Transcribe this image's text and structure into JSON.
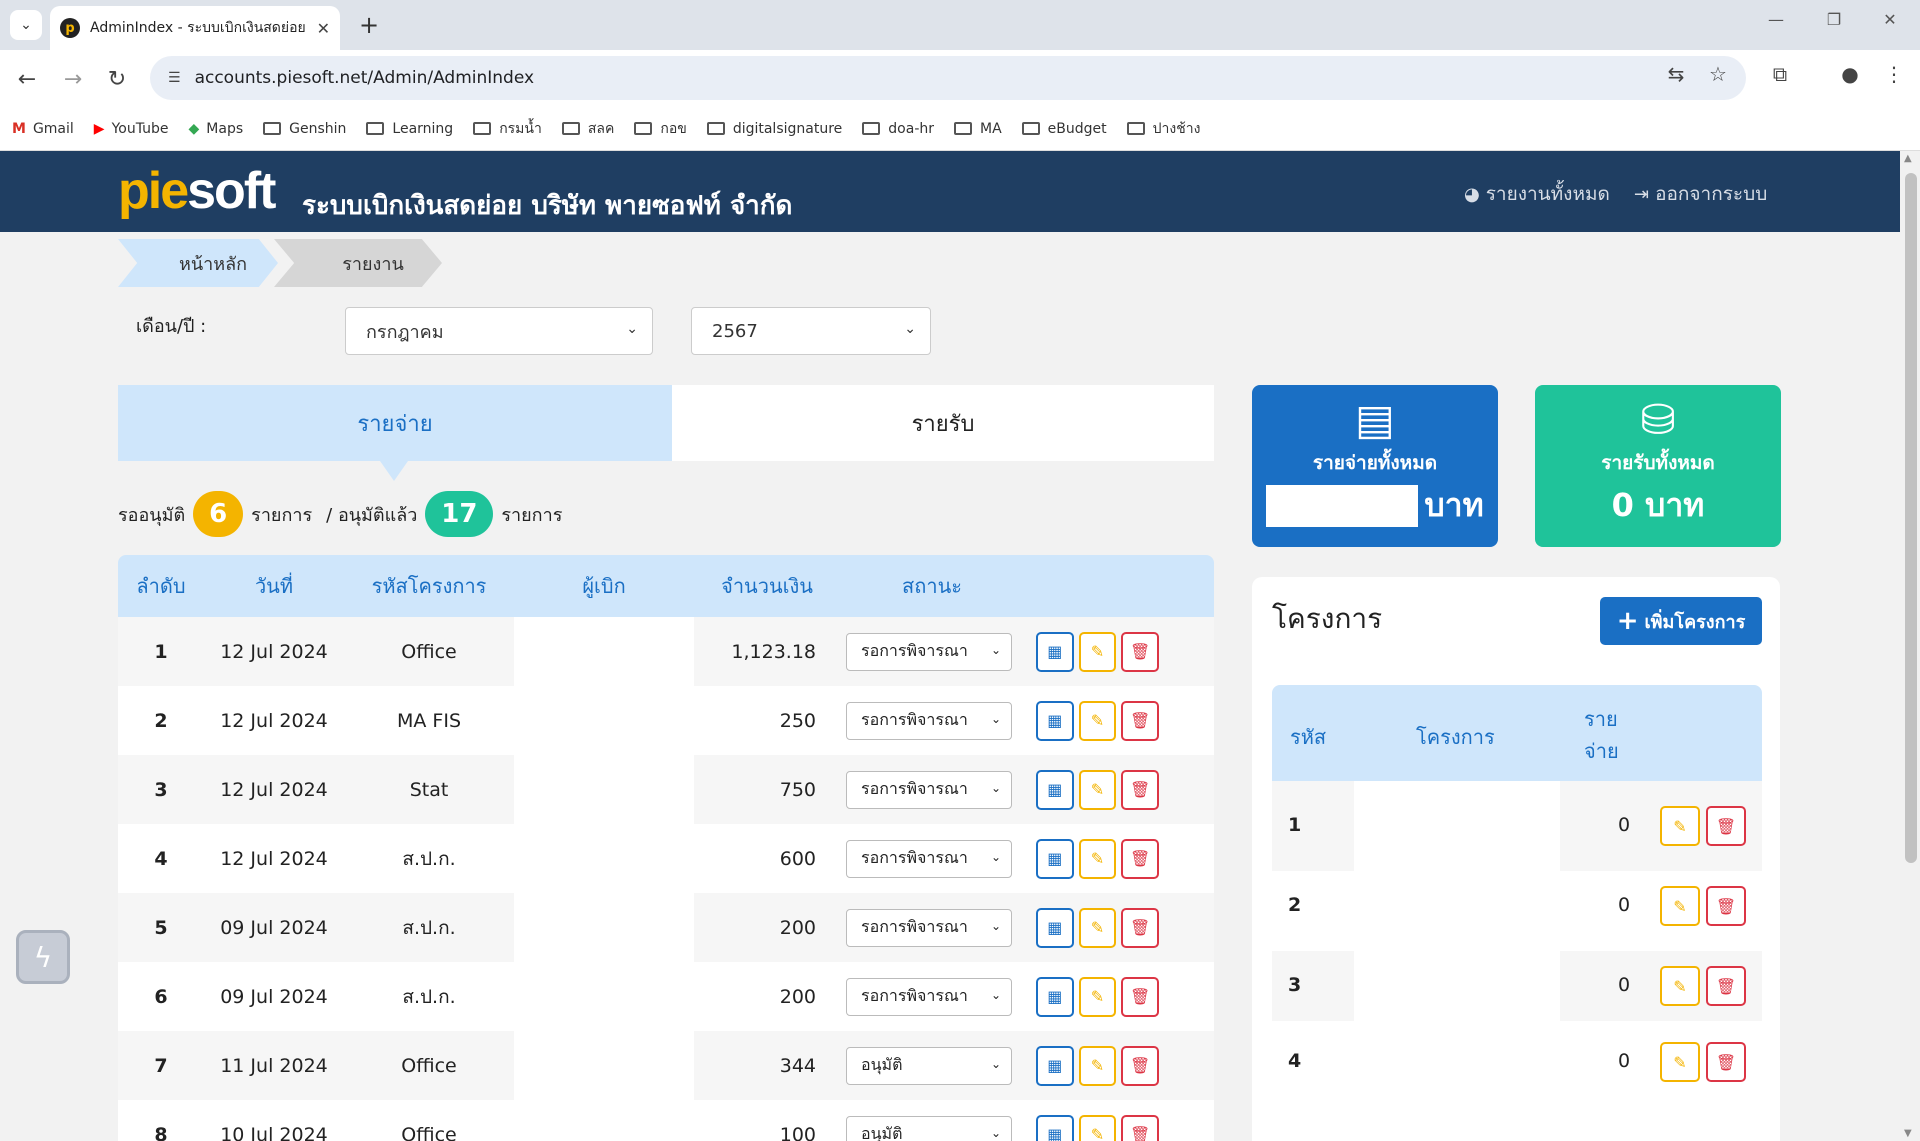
{
  "browser": {
    "tab_title": "AdminIndex - ระบบเบิกเงินสดย่อย",
    "url": "accounts.piesoft.net/Admin/AdminIndex",
    "bookmarks": [
      {
        "label": "Gmail",
        "icon": "gmail-icon"
      },
      {
        "label": "YouTube",
        "icon": "youtube-icon"
      },
      {
        "label": "Maps",
        "icon": "maps-icon"
      },
      {
        "label": "Genshin",
        "icon": "folder-icon"
      },
      {
        "label": "Learning",
        "icon": "folder-icon"
      },
      {
        "label": "กรมน้ำ",
        "icon": "folder-icon"
      },
      {
        "label": "สลค",
        "icon": "folder-icon"
      },
      {
        "label": "กอข",
        "icon": "folder-icon"
      },
      {
        "label": "digitalsignature",
        "icon": "folder-icon"
      },
      {
        "label": "doa-hr",
        "icon": "folder-icon"
      },
      {
        "label": "MA",
        "icon": "folder-icon"
      },
      {
        "label": "eBudget",
        "icon": "folder-icon"
      },
      {
        "label": "ปางช้าง",
        "icon": "folder-icon"
      }
    ]
  },
  "header": {
    "logo_pie": "pie",
    "logo_soft": "soft",
    "title": "ระบบเบิกเงินสดย่อย บริษัท พายซอฟท์ จำกัด",
    "report_link": "รายงานทั้งหมด",
    "logout_link": "ออกจากระบบ"
  },
  "breadcrumb": {
    "home": "หน้าหลัก",
    "current": "รายงาน"
  },
  "filter": {
    "label": "เดือน/ปี :",
    "month": "กรกฎาคม",
    "year": "2567"
  },
  "tabs": {
    "expense": "รายจ่าย",
    "income": "รายรับ"
  },
  "summary": {
    "pending_label": "รออนุมัติ",
    "pending_count": "6",
    "items_word": "รายการ",
    "approved_label": "/ อนุมัติแล้ว",
    "approved_count": "17"
  },
  "table": {
    "headers": [
      "ลำดับ",
      "วันที่",
      "รหัสโครงการ",
      "ผู้เบิก",
      "จำนวนเงิน",
      "สถานะ"
    ],
    "rows": [
      {
        "no": "1",
        "date": "12 Jul 2024",
        "project": "Office",
        "amount": "1,123.18",
        "status": "รอการพิจารณา"
      },
      {
        "no": "2",
        "date": "12 Jul 2024",
        "project": "MA FIS",
        "amount": "250",
        "status": "รอการพิจารณา"
      },
      {
        "no": "3",
        "date": "12 Jul 2024",
        "project": "Stat",
        "amount": "750",
        "status": "รอการพิจารณา"
      },
      {
        "no": "4",
        "date": "12 Jul 2024",
        "project": "ส.ป.ก.",
        "amount": "600",
        "status": "รอการพิจารณา"
      },
      {
        "no": "5",
        "date": "09 Jul 2024",
        "project": "ส.ป.ก.",
        "amount": "200",
        "status": "รอการพิจารณา"
      },
      {
        "no": "6",
        "date": "09 Jul 2024",
        "project": "ส.ป.ก.",
        "amount": "200",
        "status": "รอการพิจารณา"
      },
      {
        "no": "7",
        "date": "11 Jul 2024",
        "project": "Office",
        "amount": "344",
        "status": "อนุมัติ"
      },
      {
        "no": "8",
        "date": "10 Jul 2024",
        "project": "Office",
        "amount": "100",
        "status": "อนุมัติ"
      }
    ]
  },
  "cards": {
    "expense_label": "รายจ่ายทั้งหมด",
    "expense_unit": "บาท",
    "income_label": "รายรับทั้งหมด",
    "income_value": "0 บาท"
  },
  "projects": {
    "title": "โครงการ",
    "add_button": "เพิ่มโครงการ",
    "headers": {
      "code": "รหัส",
      "name": "โครงการ",
      "expense_line1": "ราย",
      "expense_line2": "จ่าย"
    },
    "rows": [
      {
        "code": "1",
        "expense": "0"
      },
      {
        "code": "2",
        "expense": "0"
      },
      {
        "code": "3",
        "expense": "0"
      },
      {
        "code": "4",
        "expense": "0"
      }
    ]
  },
  "colors": {
    "header_bg": "#1f3e62",
    "accent_blue": "#1a6fc4",
    "teal": "#1fc39a",
    "yellow": "#f4b400",
    "red": "#dc3545"
  }
}
